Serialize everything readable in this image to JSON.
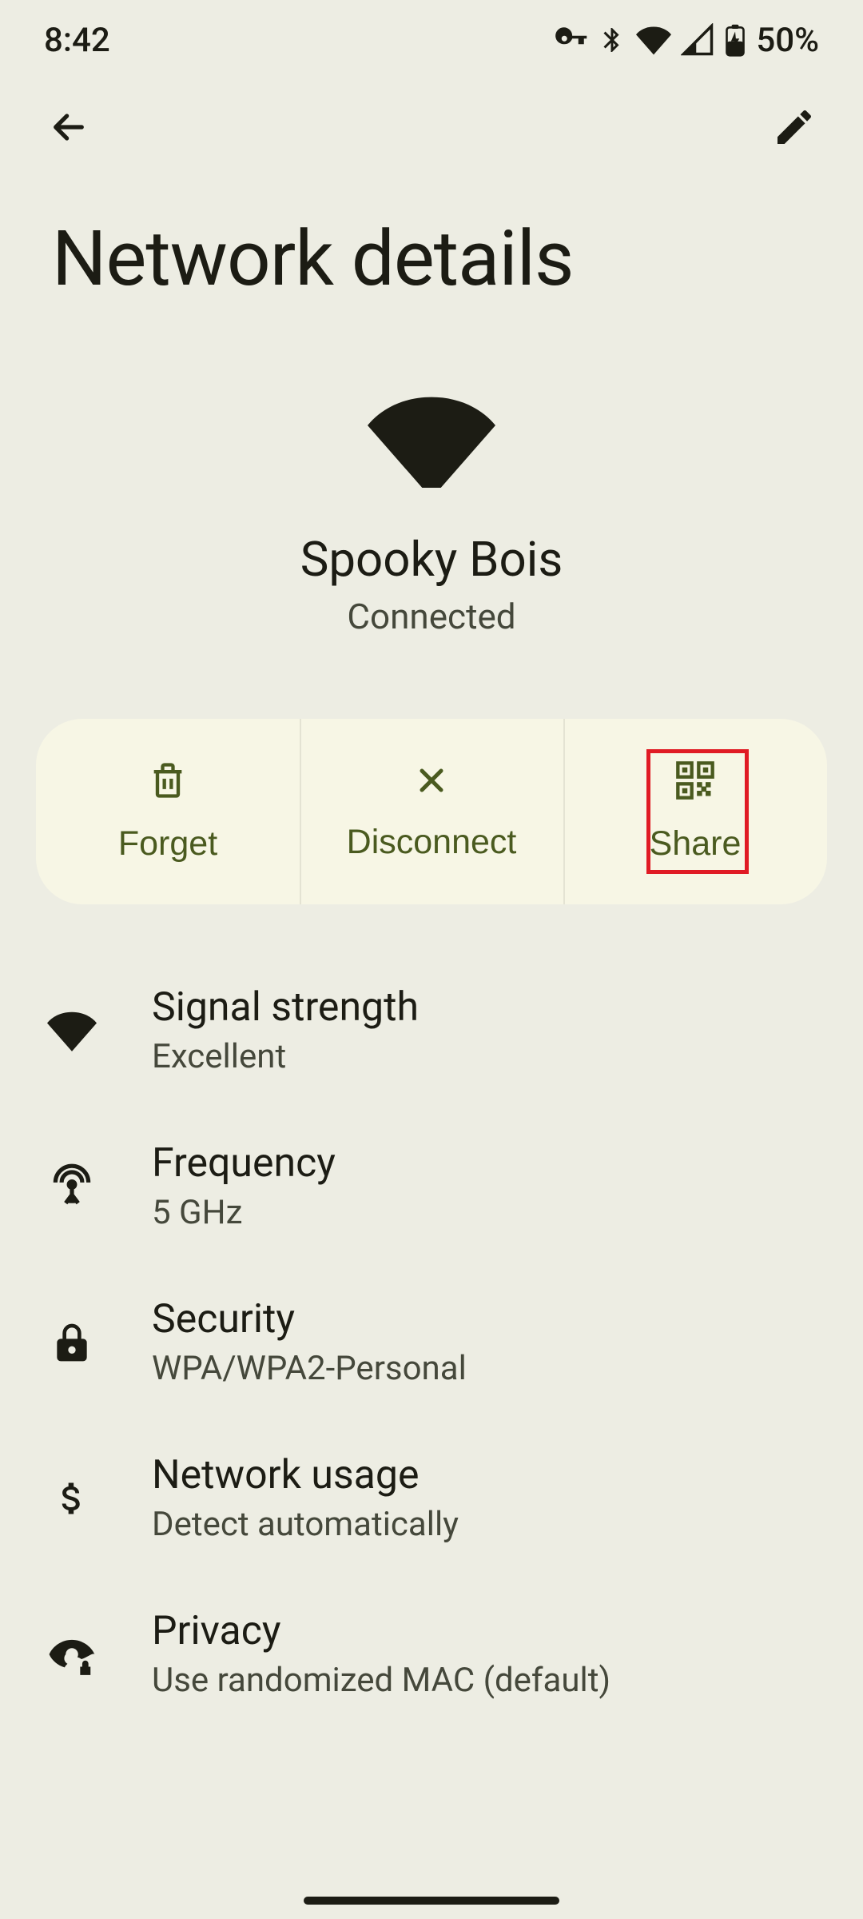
{
  "status_bar": {
    "time": "8:42",
    "battery": "50%"
  },
  "page": {
    "title": "Network details"
  },
  "network": {
    "name": "Spooky Bois",
    "status": "Connected"
  },
  "actions": {
    "forget": "Forget",
    "disconnect": "Disconnect",
    "share": "Share"
  },
  "details": [
    {
      "icon": "wifi",
      "title": "Signal strength",
      "value": "Excellent"
    },
    {
      "icon": "frequency",
      "title": "Frequency",
      "value": "5 GHz"
    },
    {
      "icon": "lock",
      "title": "Security",
      "value": "WPA/WPA2-Personal"
    },
    {
      "icon": "dollar",
      "title": "Network usage",
      "value": "Detect automatically"
    },
    {
      "icon": "eye",
      "title": "Privacy",
      "value": "Use randomized MAC (default)"
    }
  ],
  "highlight": {
    "target": "share-button"
  }
}
